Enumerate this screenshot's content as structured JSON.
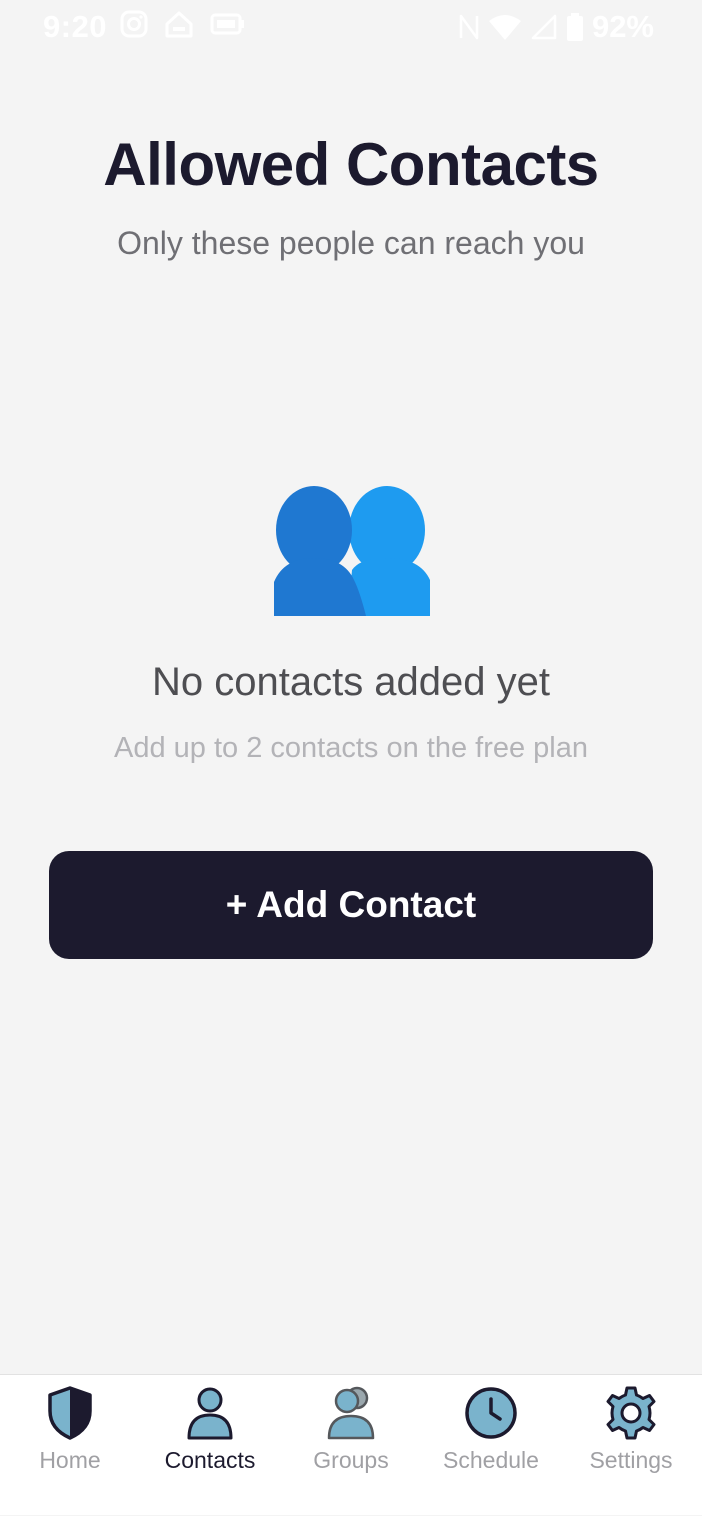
{
  "status_bar": {
    "time": "9:20",
    "battery": "92%",
    "icons": [
      "instagram-icon",
      "home-alert-icon",
      "battery-saver-icon",
      "nfc-icon",
      "wifi-icon",
      "signal-icon",
      "battery-icon"
    ]
  },
  "header": {
    "title": "Allowed Contacts",
    "subtitle": "Only these people can reach you"
  },
  "empty_state": {
    "icon": "people-icon",
    "title": "No contacts added yet",
    "description": "Add up to 2 contacts on the free plan"
  },
  "actions": {
    "add_contact_label": "+ Add Contact"
  },
  "tab_bar": {
    "active": "contacts",
    "tabs": [
      {
        "id": "home",
        "label": "Home",
        "icon": "shield-icon"
      },
      {
        "id": "contacts",
        "label": "Contacts",
        "icon": "person-icon"
      },
      {
        "id": "groups",
        "label": "Groups",
        "icon": "group-icon"
      },
      {
        "id": "schedule",
        "label": "Schedule",
        "icon": "clock-icon"
      },
      {
        "id": "settings",
        "label": "Settings",
        "icon": "gear-icon"
      }
    ]
  },
  "colors": {
    "background": "#f4f4f4",
    "primary_dark": "#1c1a2e",
    "icon_fill": "#7ab3cc",
    "people_blue_dark": "#1f78d1",
    "people_blue_light": "#1e9bf0"
  }
}
